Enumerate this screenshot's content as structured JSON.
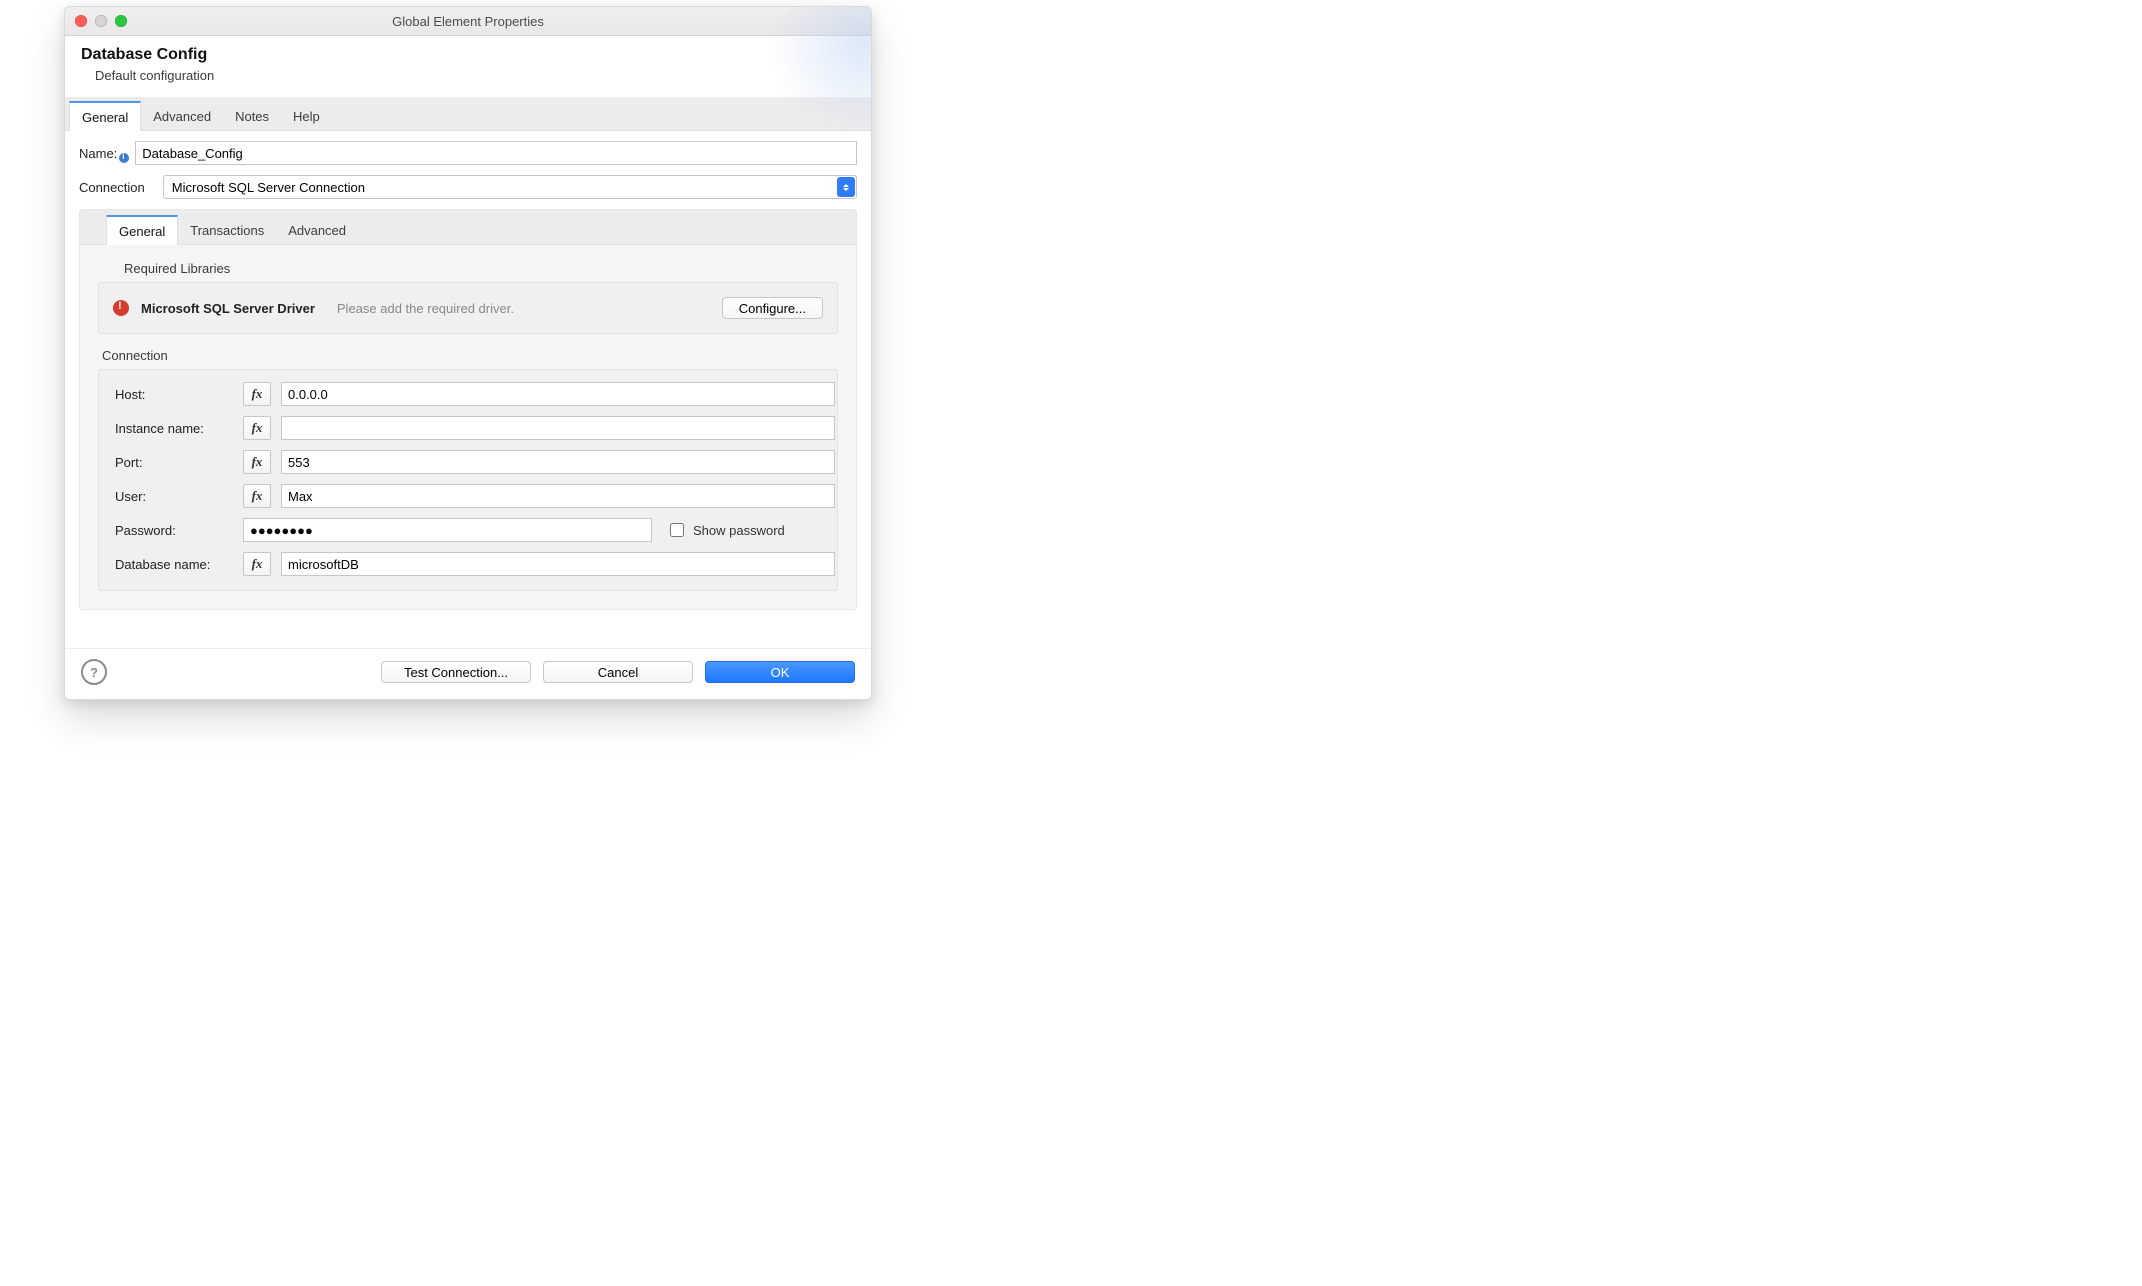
{
  "window": {
    "title": "Global Element Properties"
  },
  "header": {
    "title": "Database Config",
    "subtitle": "Default configuration"
  },
  "tabs_outer": {
    "items": [
      "General",
      "Advanced",
      "Notes",
      "Help"
    ],
    "active_index": 0
  },
  "form": {
    "name_label": "Name:",
    "name_value": "Database_Config",
    "connection_label": "Connection",
    "connection_value": "Microsoft SQL Server Connection"
  },
  "tabs_inner": {
    "items": [
      "General",
      "Transactions",
      "Advanced"
    ],
    "active_index": 0
  },
  "required_libs": {
    "section_label": "Required Libraries",
    "driver_name": "Microsoft SQL Server Driver",
    "message": "Please add the required driver.",
    "configure_label": "Configure..."
  },
  "connection": {
    "section_label": "Connection",
    "host_label": "Host:",
    "host_value": "0.0.0.0",
    "instance_label": "Instance name:",
    "instance_value": "",
    "port_label": "Port:",
    "port_value": "553",
    "user_label": "User:",
    "user_value": "Max",
    "password_label": "Password:",
    "password_display": "●●●●●●●●",
    "show_password_label": "Show password",
    "dbname_label": "Database name:",
    "dbname_value": "microsoftDB",
    "fx_label": "fx"
  },
  "footer": {
    "test_label": "Test Connection...",
    "cancel_label": "Cancel",
    "ok_label": "OK"
  }
}
